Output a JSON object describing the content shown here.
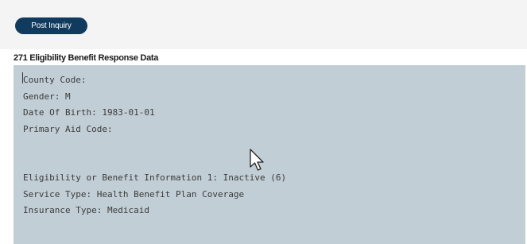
{
  "toolbar": {
    "post_inquiry_label": "Post Inquiry"
  },
  "section": {
    "title": "271 Eligibility Benefit Response Data"
  },
  "response_lines": [
    "County Code:",
    "Gender: M",
    "Date Of Birth: 1983-01-01",
    "Primary Aid Code:",
    "",
    "",
    "Eligibility or Benefit Information 1: Inactive (6)",
    "Service Type: Health Benefit Plan Coverage",
    "Insurance Type: Medicaid"
  ],
  "colors": {
    "button_bg": "#113b5e",
    "response_bg": "#c1ced6",
    "top_band_bg": "#f4f4f4"
  },
  "icons": {
    "pointer": "mouse-pointer-icon"
  }
}
